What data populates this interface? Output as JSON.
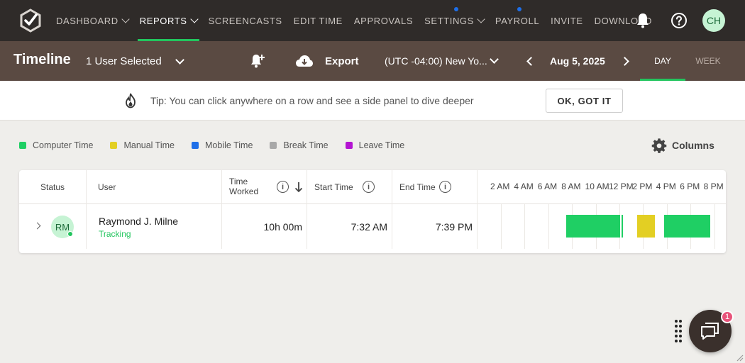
{
  "nav": {
    "items": [
      {
        "label": "DASHBOARD",
        "has_menu": true
      },
      {
        "label": "REPORTS",
        "has_menu": true,
        "active": true
      },
      {
        "label": "SCREENCASTS"
      },
      {
        "label": "EDIT TIME"
      },
      {
        "label": "APPROVALS"
      },
      {
        "label": "SETTINGS",
        "has_menu": true,
        "dot": true
      },
      {
        "label": "PAYROLL",
        "dot": true
      },
      {
        "label": "INVITE"
      },
      {
        "label": "DOWNLOAD"
      }
    ],
    "avatar_initials": "CH",
    "icons": [
      "app-logo-icon",
      "bell-icon",
      "help-icon"
    ]
  },
  "header": {
    "title": "Timeline",
    "user_selector": "1 User Selected",
    "export_label": "Export",
    "timezone": "(UTC -04:00) New Yo...",
    "date": "Aug 5, 2025",
    "tabs": [
      "DAY",
      "WEEK"
    ],
    "active_tab": "DAY"
  },
  "tip": {
    "text": "Tip: You can click anywhere on a row and see a side panel to dive deeper",
    "button": "OK, GOT IT"
  },
  "legend": [
    {
      "label": "Computer Time",
      "color": "#1fcf64"
    },
    {
      "label": "Manual Time",
      "color": "#e3cf23"
    },
    {
      "label": "Mobile Time",
      "color": "#1e6fe8"
    },
    {
      "label": "Break Time",
      "color": "#a8a8a8"
    },
    {
      "label": "Leave Time",
      "color": "#b414d2"
    }
  ],
  "columns_label": "Columns",
  "table": {
    "headers": {
      "status": "Status",
      "user": "User",
      "time_worked_1": "Time",
      "time_worked_2": "Worked",
      "start_time": "Start Time",
      "end_time": "End Time"
    },
    "timeline_ticks": [
      "2 AM",
      "4 AM",
      "6 AM",
      "8 AM",
      "10 AM",
      "12 PM",
      "2 PM",
      "4 PM",
      "6 PM",
      "8 PM"
    ],
    "rows": [
      {
        "initials": "RM",
        "name": "Raymond J. Milne",
        "status": "Tracking",
        "time_worked": "10h 00m",
        "start_time": "7:32 AM",
        "end_time": "7:39 PM",
        "segments": [
          {
            "type": "Computer Time",
            "start_hour": 7.53,
            "end_hour": 12.05
          },
          {
            "type": "Computer Time",
            "start_hour": 12.15,
            "end_hour": 12.3
          },
          {
            "type": "Manual Time",
            "start_hour": 13.5,
            "end_hour": 15.0
          },
          {
            "type": "Computer Time",
            "start_hour": 15.75,
            "end_hour": 19.65
          }
        ]
      }
    ]
  },
  "chat": {
    "badge": "1"
  }
}
